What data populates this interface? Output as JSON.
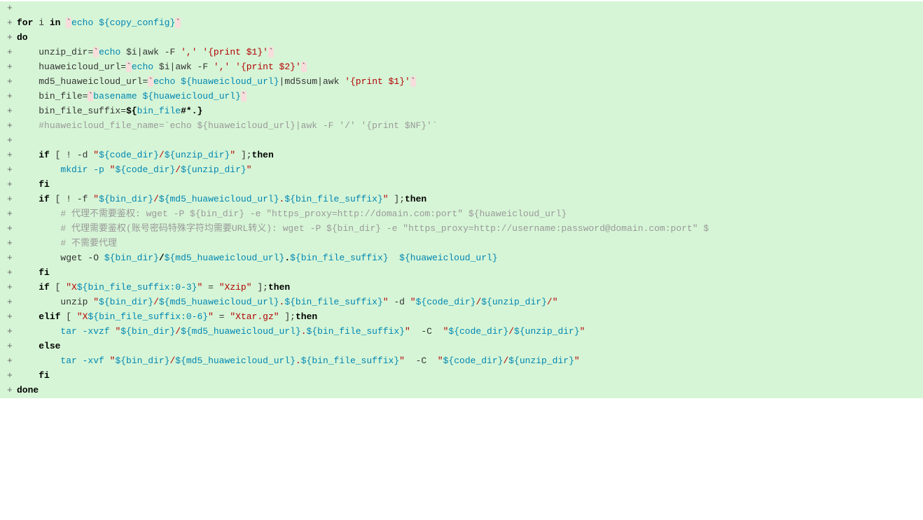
{
  "meta": {
    "viewport": "1318x743"
  },
  "sign": "+",
  "lines": {
    "l0": {
      "t0": ""
    },
    "l1": {
      "for": "for",
      "ivar": " i ",
      "in": "in",
      "sp": " ",
      "bt1": "`",
      "echo": "echo ",
      "var": "${copy_config}",
      "bt2": "`"
    },
    "l2": {
      "do": "do"
    },
    "l3": {
      "ind": "    ",
      "name": "unzip_dir",
      "eq": "=",
      "bt1": "`",
      "echo": "echo ",
      "arg": "$i",
      "pipe": "|",
      "awk": "awk -F ",
      "sep": "','",
      "sp": " ",
      "fmt": "'{print $1}'",
      "bt2": "`"
    },
    "l4": {
      "ind": "    ",
      "name": "huaweicloud_url",
      "eq": "=",
      "bt1": "`",
      "echo": "echo ",
      "arg": "$i",
      "pipe": "|",
      "awk": "awk -F ",
      "sep": "','",
      "sp": " ",
      "fmt": "'{print $2}'",
      "bt2": "`"
    },
    "l5": {
      "ind": "    ",
      "name": "md5_huaweicloud_url",
      "eq": "=",
      "bt1": "`",
      "echo": "echo ",
      "arg": "${huaweicloud_url}",
      "pipe1": "|",
      "md5": "md5sum",
      "pipe2": "|",
      "awk": "awk ",
      "fmt": "'{print $1}'",
      "bt2": "`"
    },
    "l6": {
      "ind": "    ",
      "name": "bin_file",
      "eq": "=",
      "bt1": "`",
      "basename": "basename ",
      "arg": "${huaweicloud_url}",
      "bt2": "`"
    },
    "l7": {
      "ind": "    ",
      "name": "bin_file_suffix",
      "eq": "=",
      "val_open": "${",
      "val_name": "bin_file",
      "val_close": "#*.}"
    },
    "l8": {
      "ind": "    ",
      "cmt": "#huaweicloud_file_name=`echo ${huaweicloud_url}|awk -F '/' '{print $NF}'`"
    },
    "l9": {
      "t0": ""
    },
    "l10": {
      "ind": "    ",
      "if": "if",
      "sp": " [ ! -d ",
      "q1": "\"",
      "v1": "${code_dir}",
      "slash": "/",
      "v2": "${unzip_dir}",
      "q2": "\"",
      "close": " ];",
      "then": "then"
    },
    "l11": {
      "ind": "        ",
      "mkdir": "mkdir -p ",
      "q1": "\"",
      "v1": "${code_dir}",
      "slash": "/",
      "v2": "${unzip_dir}",
      "q2": "\""
    },
    "l12": {
      "ind": "    ",
      "fi": "fi"
    },
    "l13": {
      "ind": "    ",
      "if": "if",
      "sp": " [ ! -f ",
      "q1": "\"",
      "v1": "${bin_dir}",
      "slash": "/",
      "v2": "${md5_huaweicloud_url}",
      "dot": ".",
      "v3": "${bin_file_suffix}",
      "q2": "\"",
      "close": " ];",
      "then": "then"
    },
    "l14": {
      "ind": "        ",
      "cmt": "# 代理不需要鉴权: wget -P ${bin_dir} -e \"https_proxy=http://domain.com:port\" ${huaweicloud_url}"
    },
    "l15": {
      "ind": "        ",
      "cmt": "# 代理需要鉴权(账号密码特殊字符均需要URL转义): wget -P ${bin_dir} -e \"https_proxy=http://username:password@domain.com:port\" $"
    },
    "l16": {
      "ind": "        ",
      "cmt": "# 不需要代理"
    },
    "l17": {
      "ind": "        ",
      "wget": "wget -O ",
      "v1": "${bin_dir}",
      "slash": "/",
      "v2": "${md5_huaweicloud_url}",
      "dot": ".",
      "v3": "${bin_file_suffix}",
      "sp2": "  ",
      "v4": "${huaweicloud_url}"
    },
    "l18": {
      "ind": "    ",
      "fi": "fi"
    },
    "l19": {
      "ind": "    ",
      "if": "if",
      "sp": " [ ",
      "q1": "\"",
      "x1": "X",
      "v1": "${bin_file_suffix:0-3}",
      "q2": "\"",
      "eq": " = ",
      "q3": "\"",
      "xzip": "Xzip",
      "q4": "\"",
      "close": " ];",
      "then": "then"
    },
    "l20": {
      "ind": "        ",
      "unzip": "unzip ",
      "q1": "\"",
      "v1": "${bin_dir}",
      "slash1": "/",
      "v2": "${md5_huaweicloud_url}",
      "dot": ".",
      "v3": "${bin_file_suffix}",
      "q2": "\"",
      "dflag": " -d ",
      "q3": "\"",
      "v4": "${code_dir}",
      "slash2": "/",
      "v5": "${unzip_dir}",
      "slash3": "/",
      "q4": "\""
    },
    "l21": {
      "ind": "    ",
      "elif": "elif",
      "sp": " [ ",
      "q1": "\"",
      "x1": "X",
      "v1": "${bin_file_suffix:0-6}",
      "q2": "\"",
      "eq": " = ",
      "q3": "\"",
      "xtar": "Xtar.gz",
      "q4": "\"",
      "close": " ];",
      "then": "then"
    },
    "l22": {
      "ind": "        ",
      "tar": "tar -xvzf ",
      "q1": "\"",
      "v1": "${bin_dir}",
      "slash1": "/",
      "v2": "${md5_huaweicloud_url}",
      "dot": ".",
      "v3": "${bin_file_suffix}",
      "q2": "\"",
      "cflag": "  -C  ",
      "q3": "\"",
      "v4": "${code_dir}",
      "slash2": "/",
      "v5": "${unzip_dir}",
      "q4": "\""
    },
    "l23": {
      "ind": "    ",
      "else": "else"
    },
    "l24": {
      "ind": "        ",
      "tar": "tar -xvf ",
      "q1": "\"",
      "v1": "${bin_dir}",
      "slash1": "/",
      "v2": "${md5_huaweicloud_url}",
      "dot": ".",
      "v3": "${bin_file_suffix}",
      "q2": "\"",
      "cflag": "  -C  ",
      "q3": "\"",
      "v4": "${code_dir}",
      "slash2": "/",
      "v5": "${unzip_dir}",
      "q4": "\""
    },
    "l25": {
      "ind": "    ",
      "fi": "fi"
    },
    "l26": {
      "done": "done"
    }
  }
}
